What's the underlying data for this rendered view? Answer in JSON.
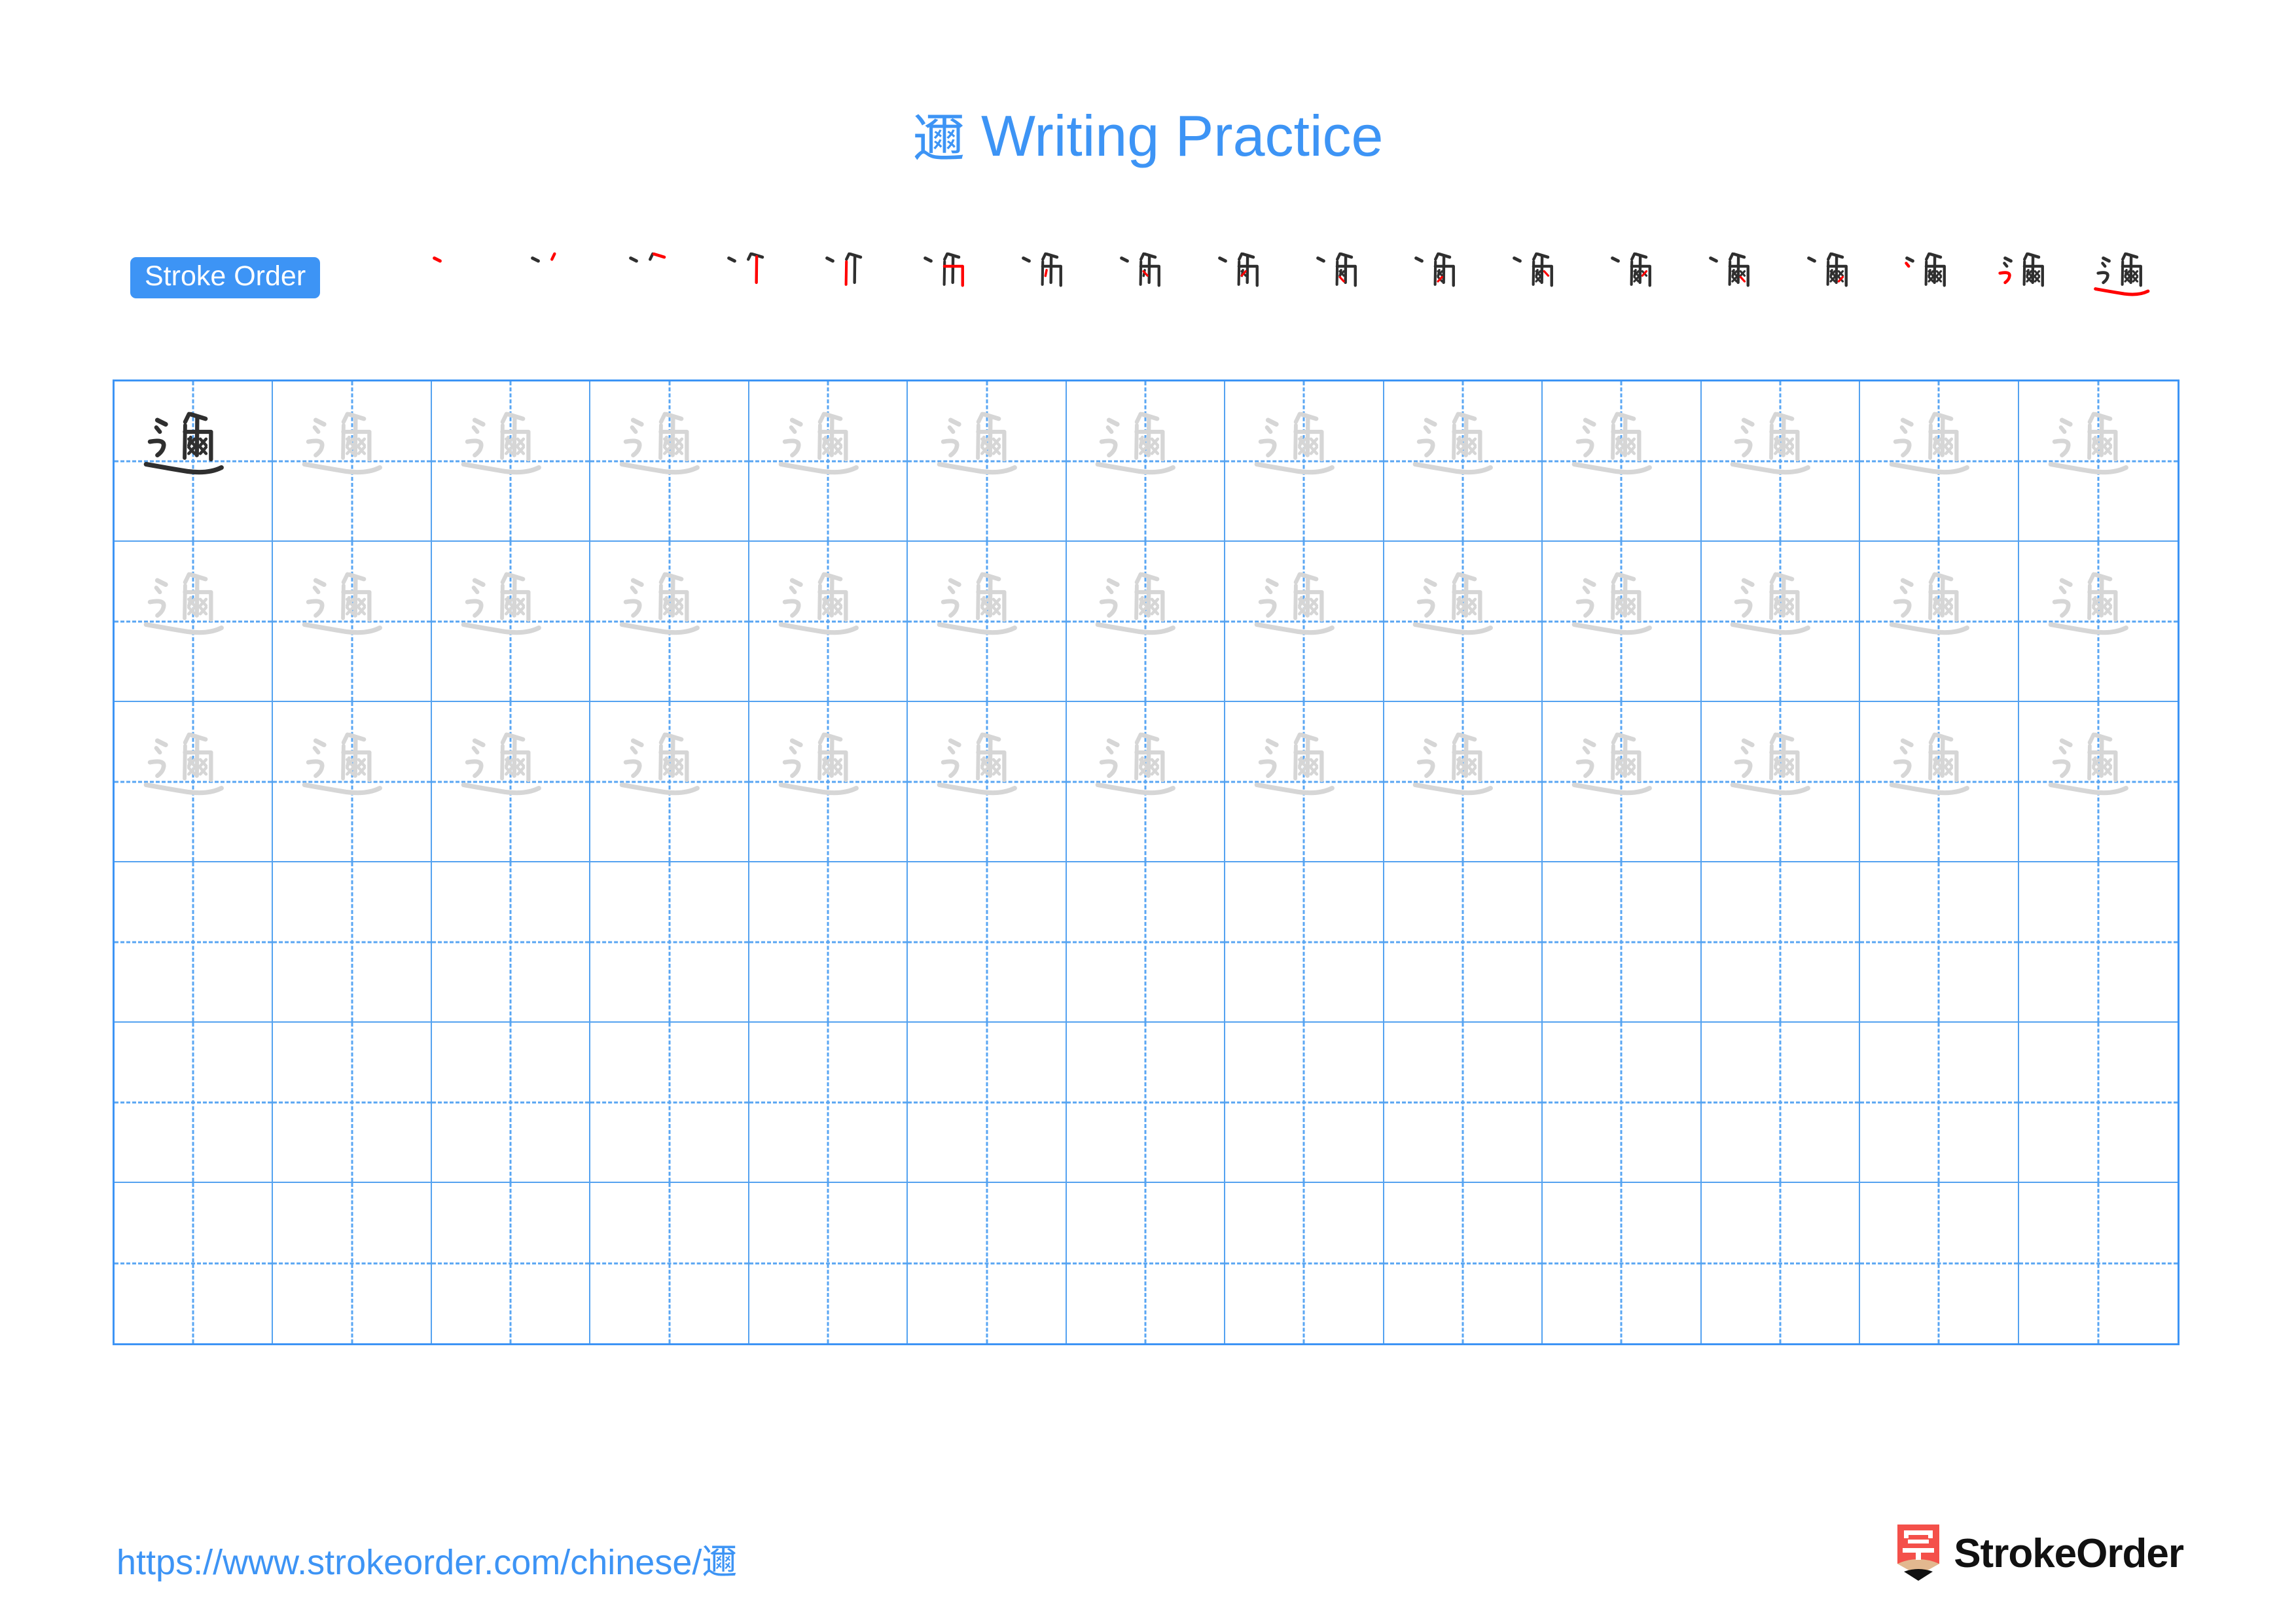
{
  "page": {
    "character": "邇",
    "title_prefix": "邇",
    "title_text": "Writing Practice",
    "accent_color": "#3d94f5",
    "trace_color": "#d6d6d6",
    "ink_color": "#2f2f2f",
    "highlight_stroke_color": "#ff0000"
  },
  "stroke_order": {
    "badge_label": "Stroke Order",
    "total_strokes": 18,
    "steps": [
      {
        "index": 1,
        "new_strokes": 1
      },
      {
        "index": 2,
        "new_strokes": 1
      },
      {
        "index": 3,
        "new_strokes": 1
      },
      {
        "index": 4,
        "new_strokes": 1
      },
      {
        "index": 5,
        "new_strokes": 1
      },
      {
        "index": 6,
        "new_strokes": 1
      },
      {
        "index": 7,
        "new_strokes": 1
      },
      {
        "index": 8,
        "new_strokes": 1
      },
      {
        "index": 9,
        "new_strokes": 1
      },
      {
        "index": 10,
        "new_strokes": 1
      },
      {
        "index": 11,
        "new_strokes": 1
      },
      {
        "index": 12,
        "new_strokes": 1
      },
      {
        "index": 13,
        "new_strokes": 1
      },
      {
        "index": 14,
        "new_strokes": 1
      },
      {
        "index": 15,
        "new_strokes": 1
      },
      {
        "index": 16,
        "new_strokes": 1
      },
      {
        "index": 17,
        "new_strokes": 1
      },
      {
        "index": 18,
        "new_strokes": 1
      }
    ]
  },
  "practice_grid": {
    "columns": 13,
    "rows": 6,
    "cells": [
      [
        "dark",
        "trace",
        "trace",
        "trace",
        "trace",
        "trace",
        "trace",
        "trace",
        "trace",
        "trace",
        "trace",
        "trace",
        "trace"
      ],
      [
        "trace",
        "trace",
        "trace",
        "trace",
        "trace",
        "trace",
        "trace",
        "trace",
        "trace",
        "trace",
        "trace",
        "trace",
        "trace"
      ],
      [
        "trace",
        "trace",
        "trace",
        "trace",
        "trace",
        "trace",
        "trace",
        "trace",
        "trace",
        "trace",
        "trace",
        "trace",
        "trace"
      ],
      [
        "empty",
        "empty",
        "empty",
        "empty",
        "empty",
        "empty",
        "empty",
        "empty",
        "empty",
        "empty",
        "empty",
        "empty",
        "empty"
      ],
      [
        "empty",
        "empty",
        "empty",
        "empty",
        "empty",
        "empty",
        "empty",
        "empty",
        "empty",
        "empty",
        "empty",
        "empty",
        "empty"
      ],
      [
        "empty",
        "empty",
        "empty",
        "empty",
        "empty",
        "empty",
        "empty",
        "empty",
        "empty",
        "empty",
        "empty",
        "empty",
        "empty"
      ]
    ]
  },
  "footer": {
    "url_prefix": "https://www.strokeorder.com/chinese/",
    "url_character": "邇",
    "brand_name": "StrokeOrder",
    "brand_mark_glyph": "字",
    "brand_mark_color": "#f4504a",
    "brand_mark_tip_color": "#e2b88f"
  }
}
